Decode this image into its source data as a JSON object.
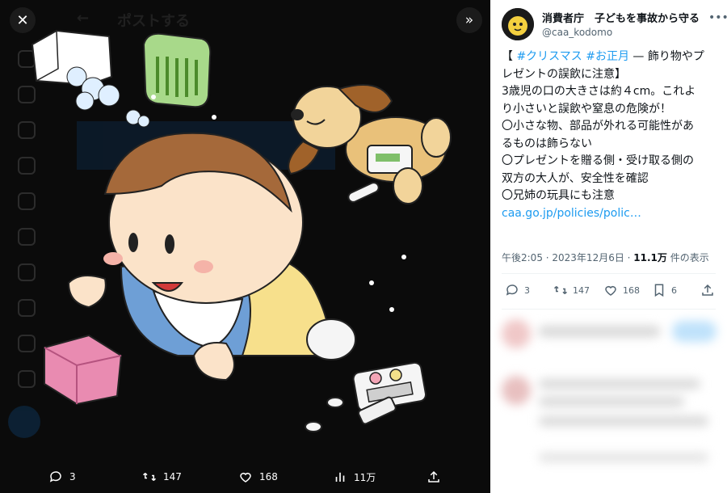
{
  "viewer": {
    "close_icon": "close-icon",
    "expand_icon": "double-chevron-right-icon",
    "bg_title": "ポストする",
    "actions": {
      "replies": "3",
      "reposts": "147",
      "likes": "168",
      "views": "11万"
    }
  },
  "tweet": {
    "author_name": "消費者庁　子どもを事故から守る",
    "author_handle": "@caa_kodomo",
    "lines": [
      {
        "pre": "【 ",
        "tag1": "#クリスマス",
        "mid": " ",
        "tag2": "#お正月",
        "post": " — 飾り物やプ"
      },
      {
        "text": "レゼントの誤飲に注意】"
      },
      {
        "text": "3歳児の口の大きさは約４cm。これよ"
      },
      {
        "text": "り小さいと誤飲や窒息の危険が！"
      },
      {
        "text": "〇小さな物、部品が外れる可能性があ"
      },
      {
        "text": "るものは飾らない"
      },
      {
        "text": "〇プレゼントを贈る側・受け取る側の"
      },
      {
        "text": "双方の大人が、安全性を確認"
      },
      {
        "text": "〇兄姉の玩具にも注意"
      }
    ],
    "link": "caa.go.jp/policies/polic…",
    "time": "午後2:05 · 2023年12月6日 · ",
    "views_count": "11.1万",
    "views_label": " 件の表示",
    "stats": {
      "replies": "3",
      "reposts": "147",
      "likes": "168",
      "bookmarks": "6"
    }
  },
  "colors": {
    "accent": "#1d9bf0",
    "viewer_bg": "#0b0b0b",
    "text": "#0f1419",
    "secondary": "#536471"
  }
}
